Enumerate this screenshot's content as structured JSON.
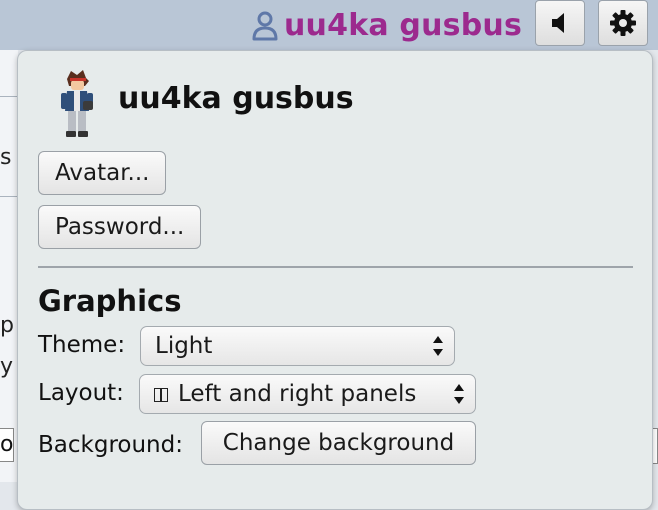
{
  "topbar": {
    "username": "uu4ka gusbus",
    "username_color": "#9c2a8e",
    "user_icon": "user-icon",
    "sound_icon": "speaker-icon",
    "settings_icon": "gear-icon"
  },
  "background_page": {
    "visible_fragments": [
      "s",
      "p",
      "y",
      "or"
    ]
  },
  "popup": {
    "avatar_icon": "trainer-avatar",
    "username": "uu4ka gusbus",
    "avatar_button": "Avatar...",
    "password_button": "Password...",
    "section_title": "Graphics",
    "theme": {
      "label": "Theme:",
      "selected": "Light"
    },
    "layout": {
      "label": "Layout:",
      "selected": "Left and right panels"
    },
    "background": {
      "label": "Background:",
      "button": "Change background"
    }
  }
}
